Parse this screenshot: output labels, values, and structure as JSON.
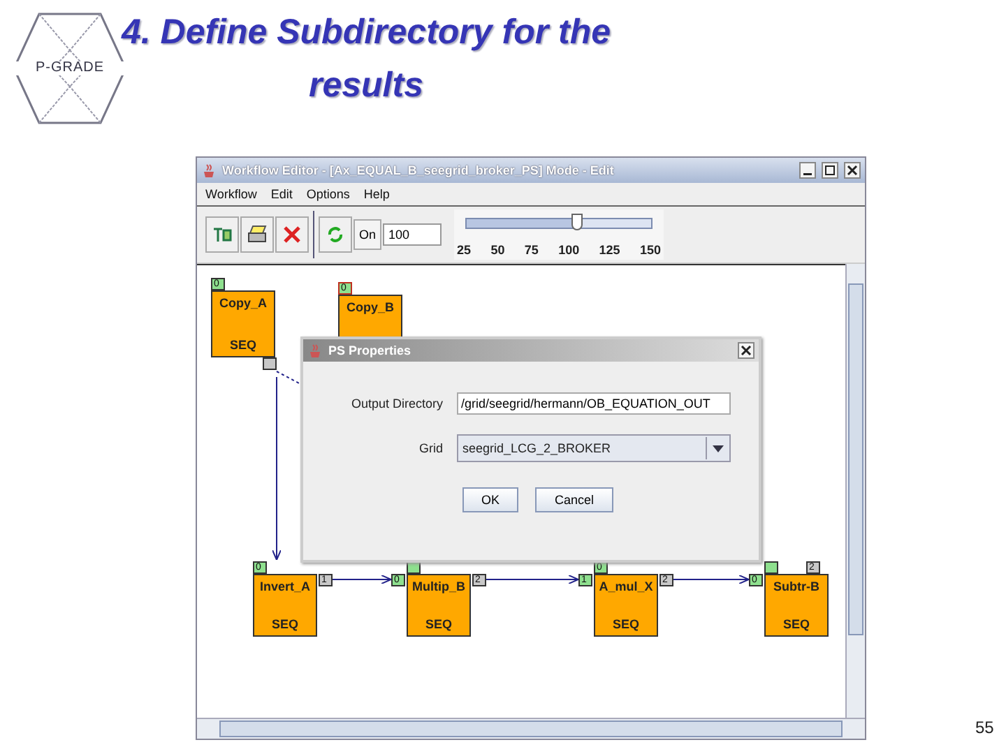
{
  "slide": {
    "logo_text": "P-GRADE",
    "title": "4. Define Subdirectory for the results",
    "page_number": "55"
  },
  "window": {
    "title": "Workflow Editor - [Ax_EQUAL_B_seegrid_broker_PS] Mode - Edit",
    "menu": [
      "Workflow",
      "Edit",
      "Options",
      "Help"
    ],
    "toolbar": {
      "zoom_label": "On",
      "zoom_value": "100",
      "slider": {
        "level": 0.6,
        "ticks": [
          "25",
          "50",
          "75",
          "100",
          "125",
          "150"
        ]
      }
    },
    "canvas": {
      "nodes": [
        {
          "name": "Copy_A",
          "type": "SEQ",
          "ports": [
            {
              "kind": "input",
              "label": "0",
              "selected": false
            },
            {
              "kind": "output",
              "selected": false
            }
          ]
        },
        {
          "name": "Copy_B",
          "ports": [
            {
              "kind": "input",
              "label": "0",
              "selected": true
            }
          ]
        },
        {
          "name": "Invert_A",
          "type": "SEQ",
          "ports": [
            {
              "kind": "input",
              "label": "0",
              "selected": false
            },
            {
              "kind": "output",
              "label": "1",
              "selected": false
            }
          ]
        },
        {
          "name": "Multip_B",
          "type": "SEQ",
          "ports": [
            {
              "kind": "input",
              "label": "0",
              "selected": false
            },
            {
              "kind": "input",
              "selected": false
            },
            {
              "kind": "output",
              "label": "2",
              "selected": false
            }
          ]
        },
        {
          "name": "A_mul_X",
          "type": "SEQ",
          "ports": [
            {
              "kind": "input",
              "label": "1",
              "selected": false
            },
            {
              "kind": "input",
              "label": "0",
              "selected": false
            },
            {
              "kind": "output",
              "label": "2",
              "selected": false
            }
          ]
        },
        {
          "name": "Subtr-B",
          "type": "SEQ",
          "ports": [
            {
              "kind": "input",
              "label": "0",
              "selected": false
            },
            {
              "kind": "input",
              "selected": false
            },
            {
              "kind": "output",
              "label": "2",
              "selected": false
            }
          ]
        }
      ],
      "dialog": {
        "title": "PS Properties",
        "output_directory_label": "Output Directory",
        "output_directory_value": "/grid/seegrid/hermann/OB_EQUATION_OUT",
        "grid_label": "Grid",
        "grid_value": "seegrid_LCG_2_BROKER",
        "buttons": [
          "OK",
          "Cancel"
        ]
      }
    }
  }
}
